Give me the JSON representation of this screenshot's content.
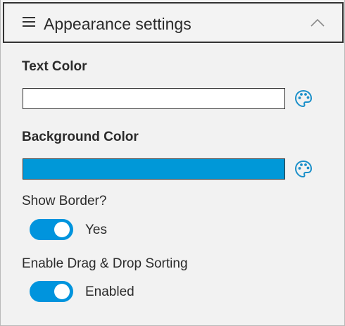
{
  "panel": {
    "title": "Appearance settings",
    "menu_icon": "hamburger-menu-icon",
    "collapse_icon": "chevron-up-icon"
  },
  "text_color": {
    "label": "Text Color",
    "value_color": "#ffffff",
    "picker_icon": "palette-icon"
  },
  "background_color": {
    "label": "Background Color",
    "value_color": "#0098d8",
    "picker_icon": "palette-icon"
  },
  "show_border": {
    "label": "Show Border?",
    "checked": true,
    "state_text": "Yes"
  },
  "drag_drop": {
    "label": "Enable Drag & Drop Sorting",
    "checked": true,
    "state_text": "Enabled"
  },
  "colors": {
    "accent": "#0094dd",
    "icon": "#1a8fc9"
  }
}
